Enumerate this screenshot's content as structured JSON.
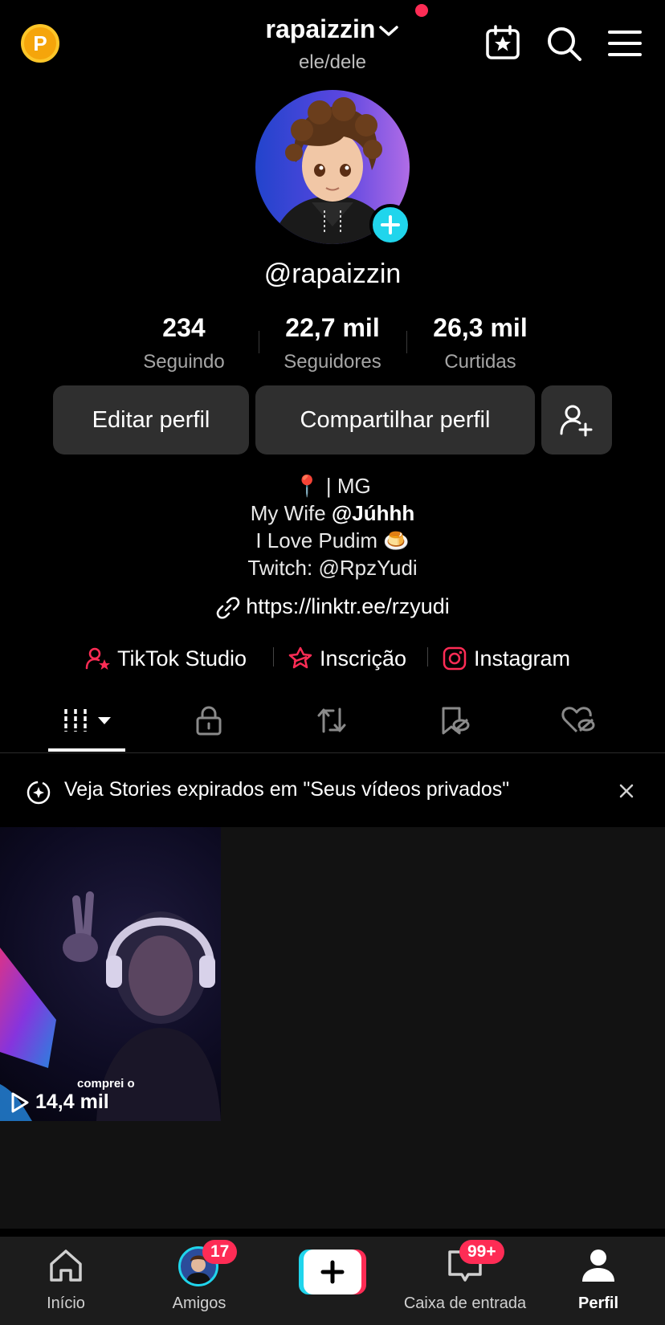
{
  "header": {
    "coin_letter": "P",
    "username": "rapaizzin",
    "pronouns": "ele/dele"
  },
  "profile": {
    "handle": "@rapaizzin"
  },
  "stats": [
    {
      "value": "234",
      "label": "Seguindo"
    },
    {
      "value": "22,7 mil",
      "label": "Seguidores"
    },
    {
      "value": "26,3 mil",
      "label": "Curtidas"
    }
  ],
  "actions": {
    "edit_label": "Editar perfil",
    "share_label": "Compartilhar perfil"
  },
  "bio": {
    "line1": "📍 | MG",
    "line2_prefix": "My Wife ",
    "line2_mention": "@Júhhh",
    "line3": "I Love Pudim 🍮",
    "line4": "Twitch: @RpzYudi",
    "link": "https://linktr.ee/rzyudi"
  },
  "shortcuts": [
    {
      "label": "TikTok Studio"
    },
    {
      "label": "Inscrição"
    },
    {
      "label": "Instagram"
    }
  ],
  "banner": {
    "text": "Veja Stories expirados em \"Seus vídeos privados\""
  },
  "videos": [
    {
      "caption": "comprei o",
      "views": "14,4 mil"
    }
  ],
  "nav": {
    "home": "Início",
    "friends": "Amigos",
    "friends_badge": "17",
    "inbox": "Caixa de entrada",
    "inbox_badge": "99+",
    "profile": "Perfil"
  },
  "colors": {
    "accent_red": "#fe2c55",
    "accent_cyan": "#20d5ec",
    "button_bg": "#2f2f2f",
    "coin": "#f5a50b"
  }
}
